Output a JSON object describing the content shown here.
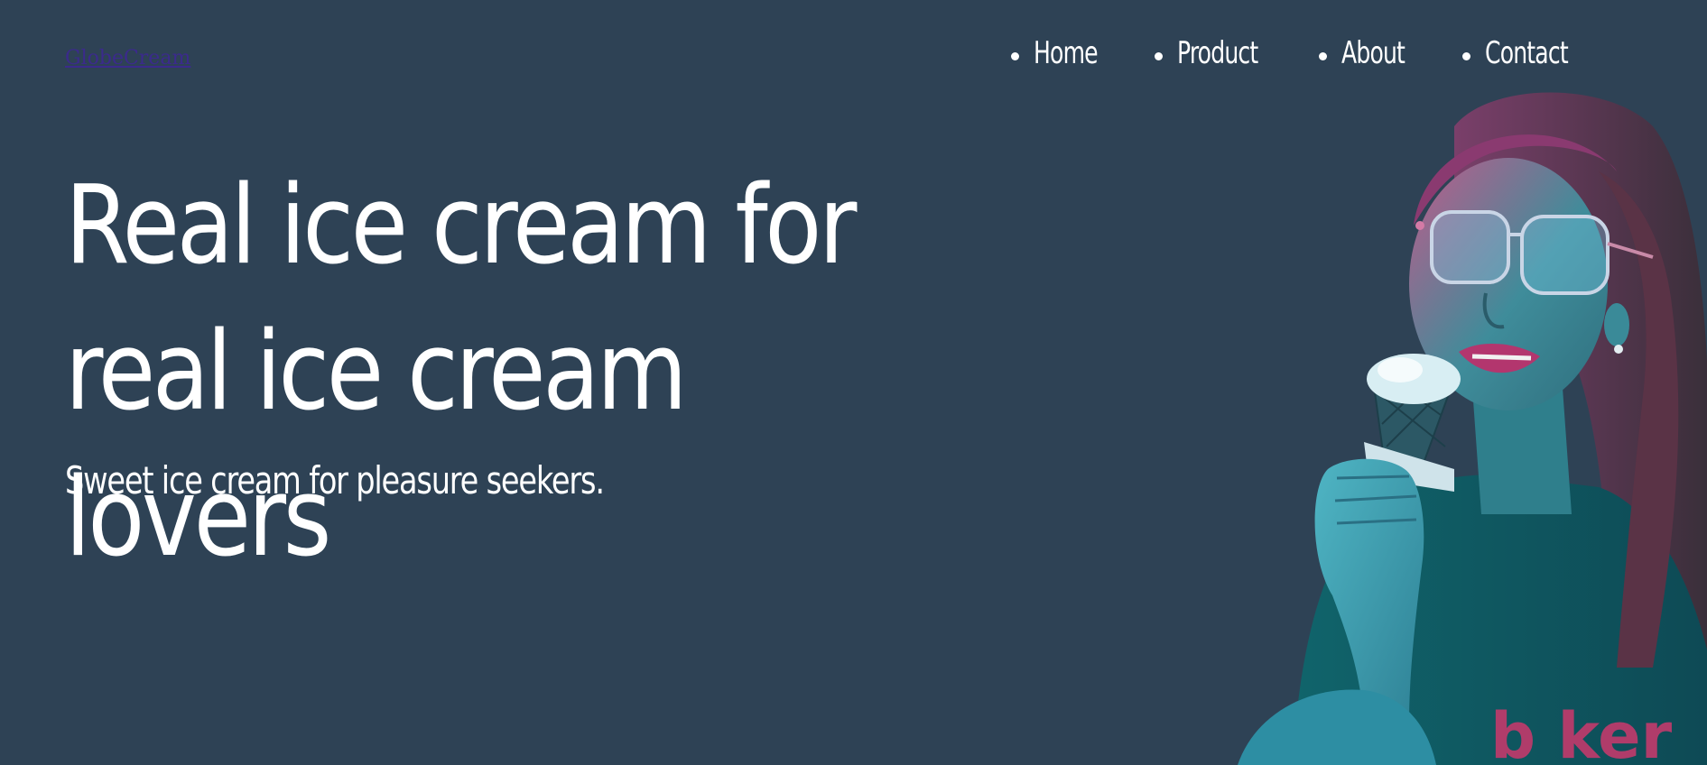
{
  "header": {
    "logo_text": "GlobeCream",
    "nav": [
      {
        "label": "Home"
      },
      {
        "label": "Product"
      },
      {
        "label": "About"
      },
      {
        "label": "Contact"
      }
    ]
  },
  "hero": {
    "title": "Real ice cream for real ice cream lovers",
    "subtitle": "Sweet ice cream for pleasure seekers."
  },
  "colors": {
    "background": "#2e4255",
    "text": "#ffffff",
    "logo_link": "#3b2a8c"
  }
}
